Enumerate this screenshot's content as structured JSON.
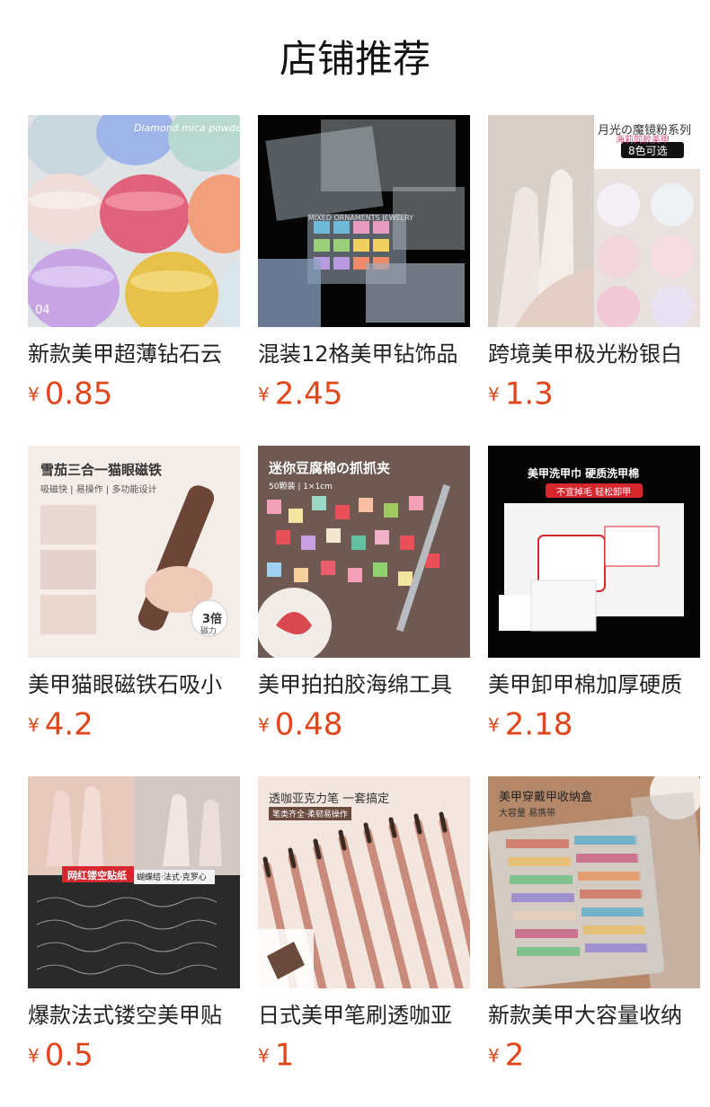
{
  "page": {
    "title": "店铺推荐"
  },
  "colors": {
    "price": "#e0451b",
    "title": "#111111"
  },
  "products": [
    {
      "name": "新款美甲超薄钻石云",
      "currency": "¥",
      "price": "0.85",
      "overlay": [
        "Diamond mica powder",
        "04"
      ]
    },
    {
      "name": "混装12格美甲钻饰品",
      "currency": "¥",
      "price": "2.45",
      "overlay": [
        "MIXED ORNAMENTS JEWELRY"
      ]
    },
    {
      "name": "跨境美甲极光粉银白",
      "currency": "¥",
      "price": "1.3",
      "overlay": [
        "月光の魔镜粉系列",
        "海莉同款美甲",
        "8色可选"
      ]
    },
    {
      "name": "美甲猫眼磁铁石吸小",
      "currency": "¥",
      "price": "4.2",
      "overlay": [
        "雪茄三合一猫眼磁铁",
        "吸磁快 | 易操作 | 多功能设计",
        "3倍",
        "磁力"
      ]
    },
    {
      "name": "美甲拍拍胶海绵工具",
      "currency": "¥",
      "price": "0.48",
      "overlay": [
        "迷你豆腐棉の抓抓夹",
        "50颗装 | 1×1cm"
      ]
    },
    {
      "name": "美甲卸甲棉加厚硬质",
      "currency": "¥",
      "price": "2.18",
      "overlay": [
        "美甲洗甲巾  硬质洗甲棉",
        "不宜掉毛 轻松卸甲"
      ]
    },
    {
      "name": "爆款法式镂空美甲贴",
      "currency": "¥",
      "price": "0.5",
      "overlay": [
        "网红镂空贴纸",
        "蝴蝶结·法式·克罗心"
      ]
    },
    {
      "name": "日式美甲笔刷透咖亚",
      "currency": "¥",
      "price": "1",
      "overlay": [
        "透咖亚克力笔  一套搞定",
        "笔类齐全·柔韧易操作"
      ]
    },
    {
      "name": "新款美甲大容量收纳",
      "currency": "¥",
      "price": "2",
      "overlay": [
        "美甲穿戴甲收纳盒",
        "大容量 易携带"
      ]
    }
  ]
}
